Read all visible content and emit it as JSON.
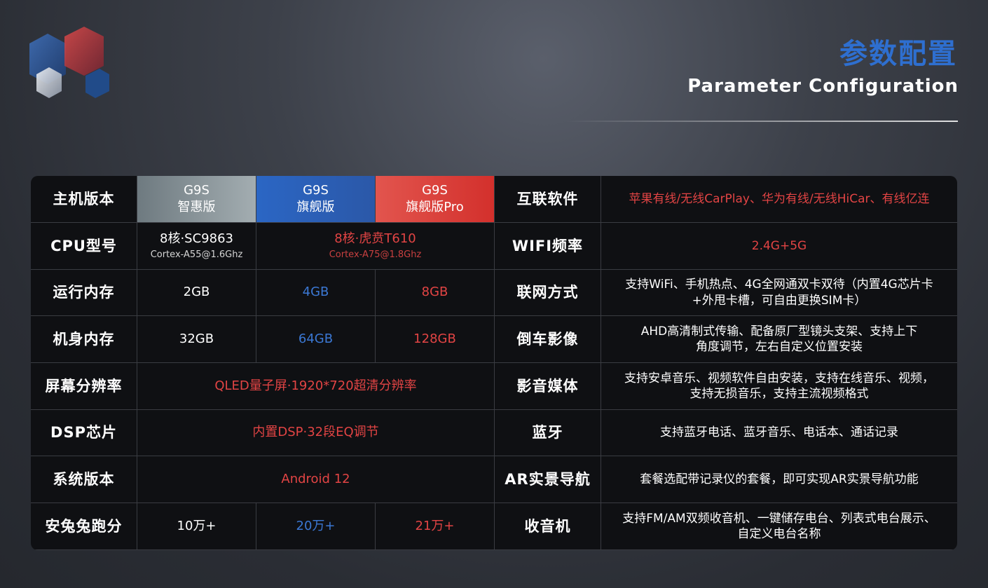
{
  "title_cn": "参数配置",
  "title_en": "Parameter Configuration",
  "colors": {
    "accent_blue": "#2e6fd0",
    "accent_red": "#e24444"
  },
  "left": {
    "header": {
      "label": "主机版本",
      "cols": [
        {
          "name": "G9S",
          "edition": "智惠版"
        },
        {
          "name": "G9S",
          "edition": "旗舰版"
        },
        {
          "name": "G9S",
          "edition": "旗舰版Pro"
        }
      ]
    },
    "cpu": {
      "label": "CPU型号",
      "basic": {
        "main": "8核·SC9863",
        "sub": "Cortex-A55@1.6Ghz"
      },
      "flagship": {
        "main": "8核·虎贲T610",
        "sub": "Cortex-A75@1.8Ghz"
      }
    },
    "ram": {
      "label": "运行内存",
      "values": [
        "2GB",
        "4GB",
        "8GB"
      ]
    },
    "storage": {
      "label": "机身内存",
      "values": [
        "32GB",
        "64GB",
        "128GB"
      ]
    },
    "screen": {
      "label": "屏幕分辨率",
      "value": "QLED量子屏·1920*720超清分辨率"
    },
    "dsp": {
      "label": "DSP芯片",
      "value": "内置DSP·32段EQ调节"
    },
    "os": {
      "label": "系统版本",
      "value": "Android 12"
    },
    "antutu": {
      "label": "安兔兔跑分",
      "values": [
        "10万+",
        "20万+",
        "21万+"
      ]
    }
  },
  "right": [
    {
      "label": "互联软件",
      "value": "苹果有线/无线CarPlay、华为有线/无线HiCar、有线亿连",
      "style": "red"
    },
    {
      "label": "WIFI频率",
      "value": "2.4G+5G",
      "style": "red"
    },
    {
      "label": "联网方式",
      "line1": "支持WiFi、手机热点、4G全网通双卡双待（内置4G芯片卡",
      "line2": "+外甩卡槽，可自由更换SIM卡）"
    },
    {
      "label": "倒车影像",
      "line1": "AHD高清制式传输、配备原厂型镜头支架、支持上下",
      "line2": "角度调节，左右自定义位置安装"
    },
    {
      "label": "影音媒体",
      "line1": "支持安卓音乐、视频软件自由安装，支持在线音乐、视频，",
      "line2": "支持无损音乐，支持主流视频格式"
    },
    {
      "label": "蓝牙",
      "value": "支持蓝牙电话、蓝牙音乐、电话本、通话记录"
    },
    {
      "label": "AR实景导航",
      "value": "套餐选配带记录仪的套餐，即可实现AR实景导航功能"
    },
    {
      "label": "收音机",
      "line1": "支持FM/AM双频收音机、一键储存电台、列表式电台展示、",
      "line2": "自定义电台名称"
    }
  ]
}
